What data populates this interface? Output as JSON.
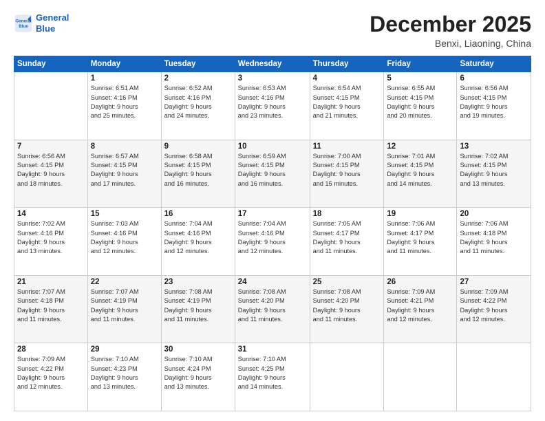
{
  "logo": {
    "line1": "General",
    "line2": "Blue"
  },
  "title": "December 2025",
  "subtitle": "Benxi, Liaoning, China",
  "days_of_week": [
    "Sunday",
    "Monday",
    "Tuesday",
    "Wednesday",
    "Thursday",
    "Friday",
    "Saturday"
  ],
  "weeks": [
    [
      {
        "day": "",
        "info": ""
      },
      {
        "day": "1",
        "info": "Sunrise: 6:51 AM\nSunset: 4:16 PM\nDaylight: 9 hours\nand 25 minutes."
      },
      {
        "day": "2",
        "info": "Sunrise: 6:52 AM\nSunset: 4:16 PM\nDaylight: 9 hours\nand 24 minutes."
      },
      {
        "day": "3",
        "info": "Sunrise: 6:53 AM\nSunset: 4:16 PM\nDaylight: 9 hours\nand 23 minutes."
      },
      {
        "day": "4",
        "info": "Sunrise: 6:54 AM\nSunset: 4:15 PM\nDaylight: 9 hours\nand 21 minutes."
      },
      {
        "day": "5",
        "info": "Sunrise: 6:55 AM\nSunset: 4:15 PM\nDaylight: 9 hours\nand 20 minutes."
      },
      {
        "day": "6",
        "info": "Sunrise: 6:56 AM\nSunset: 4:15 PM\nDaylight: 9 hours\nand 19 minutes."
      }
    ],
    [
      {
        "day": "7",
        "info": "Sunrise: 6:56 AM\nSunset: 4:15 PM\nDaylight: 9 hours\nand 18 minutes."
      },
      {
        "day": "8",
        "info": "Sunrise: 6:57 AM\nSunset: 4:15 PM\nDaylight: 9 hours\nand 17 minutes."
      },
      {
        "day": "9",
        "info": "Sunrise: 6:58 AM\nSunset: 4:15 PM\nDaylight: 9 hours\nand 16 minutes."
      },
      {
        "day": "10",
        "info": "Sunrise: 6:59 AM\nSunset: 4:15 PM\nDaylight: 9 hours\nand 16 minutes."
      },
      {
        "day": "11",
        "info": "Sunrise: 7:00 AM\nSunset: 4:15 PM\nDaylight: 9 hours\nand 15 minutes."
      },
      {
        "day": "12",
        "info": "Sunrise: 7:01 AM\nSunset: 4:15 PM\nDaylight: 9 hours\nand 14 minutes."
      },
      {
        "day": "13",
        "info": "Sunrise: 7:02 AM\nSunset: 4:15 PM\nDaylight: 9 hours\nand 13 minutes."
      }
    ],
    [
      {
        "day": "14",
        "info": "Sunrise: 7:02 AM\nSunset: 4:16 PM\nDaylight: 9 hours\nand 13 minutes."
      },
      {
        "day": "15",
        "info": "Sunrise: 7:03 AM\nSunset: 4:16 PM\nDaylight: 9 hours\nand 12 minutes."
      },
      {
        "day": "16",
        "info": "Sunrise: 7:04 AM\nSunset: 4:16 PM\nDaylight: 9 hours\nand 12 minutes."
      },
      {
        "day": "17",
        "info": "Sunrise: 7:04 AM\nSunset: 4:16 PM\nDaylight: 9 hours\nand 12 minutes."
      },
      {
        "day": "18",
        "info": "Sunrise: 7:05 AM\nSunset: 4:17 PM\nDaylight: 9 hours\nand 11 minutes."
      },
      {
        "day": "19",
        "info": "Sunrise: 7:06 AM\nSunset: 4:17 PM\nDaylight: 9 hours\nand 11 minutes."
      },
      {
        "day": "20",
        "info": "Sunrise: 7:06 AM\nSunset: 4:18 PM\nDaylight: 9 hours\nand 11 minutes."
      }
    ],
    [
      {
        "day": "21",
        "info": "Sunrise: 7:07 AM\nSunset: 4:18 PM\nDaylight: 9 hours\nand 11 minutes."
      },
      {
        "day": "22",
        "info": "Sunrise: 7:07 AM\nSunset: 4:19 PM\nDaylight: 9 hours\nand 11 minutes."
      },
      {
        "day": "23",
        "info": "Sunrise: 7:08 AM\nSunset: 4:19 PM\nDaylight: 9 hours\nand 11 minutes."
      },
      {
        "day": "24",
        "info": "Sunrise: 7:08 AM\nSunset: 4:20 PM\nDaylight: 9 hours\nand 11 minutes."
      },
      {
        "day": "25",
        "info": "Sunrise: 7:08 AM\nSunset: 4:20 PM\nDaylight: 9 hours\nand 11 minutes."
      },
      {
        "day": "26",
        "info": "Sunrise: 7:09 AM\nSunset: 4:21 PM\nDaylight: 9 hours\nand 12 minutes."
      },
      {
        "day": "27",
        "info": "Sunrise: 7:09 AM\nSunset: 4:22 PM\nDaylight: 9 hours\nand 12 minutes."
      }
    ],
    [
      {
        "day": "28",
        "info": "Sunrise: 7:09 AM\nSunset: 4:22 PM\nDaylight: 9 hours\nand 12 minutes."
      },
      {
        "day": "29",
        "info": "Sunrise: 7:10 AM\nSunset: 4:23 PM\nDaylight: 9 hours\nand 13 minutes."
      },
      {
        "day": "30",
        "info": "Sunrise: 7:10 AM\nSunset: 4:24 PM\nDaylight: 9 hours\nand 13 minutes."
      },
      {
        "day": "31",
        "info": "Sunrise: 7:10 AM\nSunset: 4:25 PM\nDaylight: 9 hours\nand 14 minutes."
      },
      {
        "day": "",
        "info": ""
      },
      {
        "day": "",
        "info": ""
      },
      {
        "day": "",
        "info": ""
      }
    ]
  ]
}
